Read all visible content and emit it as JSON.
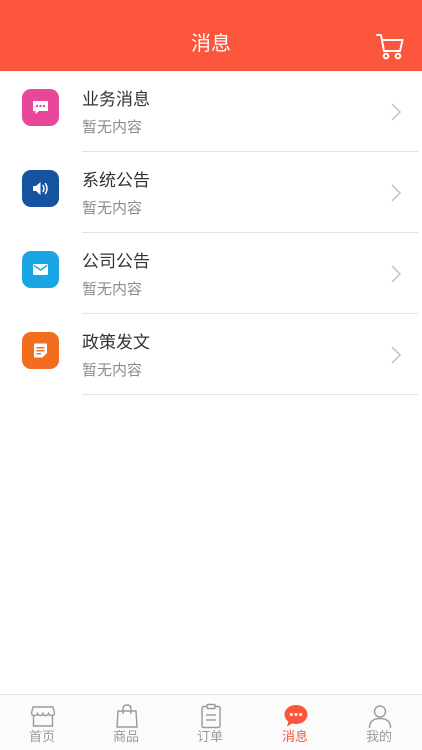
{
  "header": {
    "title": "消息"
  },
  "messages": [
    {
      "title": "业务消息",
      "subtitle": "暂无内容",
      "icon": "chat-bubble-icon",
      "color": "#e8479a"
    },
    {
      "title": "系统公告",
      "subtitle": "暂无内容",
      "icon": "speaker-icon",
      "color": "#14539f"
    },
    {
      "title": "公司公告",
      "subtitle": "暂无内容",
      "icon": "mail-icon",
      "color": "#1aa5e3"
    },
    {
      "title": "政策发文",
      "subtitle": "暂无内容",
      "icon": "document-icon",
      "color": "#f26d1d"
    }
  ],
  "tabbar": {
    "items": [
      {
        "label": "首页",
        "icon": "store-icon"
      },
      {
        "label": "商品",
        "icon": "shopping-bag-icon"
      },
      {
        "label": "订单",
        "icon": "clipboard-icon"
      },
      {
        "label": "消息",
        "icon": "chat-bubble-icon",
        "active": true
      },
      {
        "label": "我的",
        "icon": "person-icon"
      }
    ]
  },
  "colors": {
    "brand": "#fb563b",
    "inactive": "#9a9a9a"
  }
}
